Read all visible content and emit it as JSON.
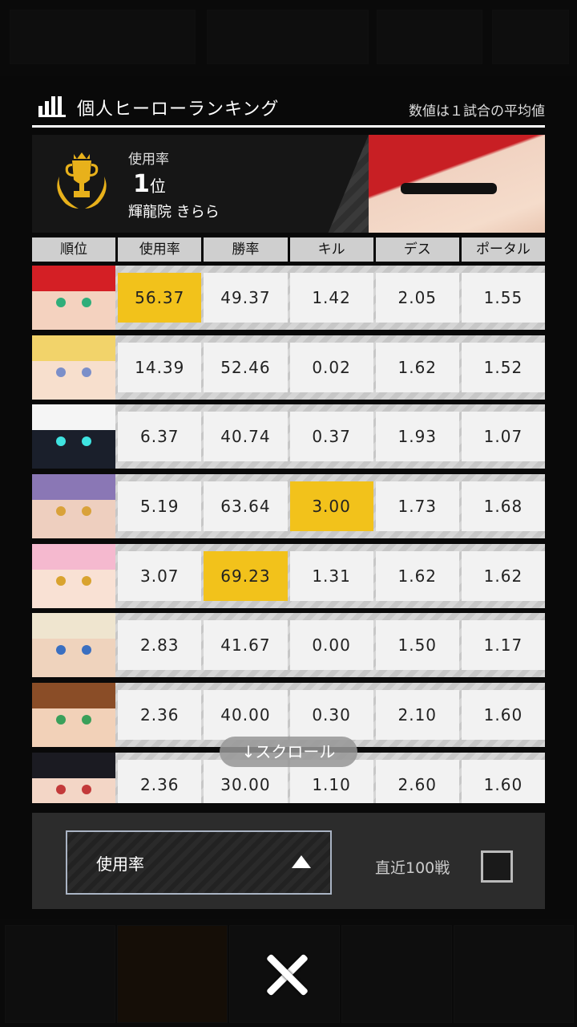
{
  "header": {
    "title": "個人ヒーローランキング",
    "note": "数値は１試合の平均値"
  },
  "banner": {
    "label": "使用率",
    "rank": "1",
    "rank_suffix": "位",
    "hero_name": "輝龍院 きらら"
  },
  "columns": [
    "順位",
    "使用率",
    "勝率",
    "キル",
    "デス",
    "ポータル"
  ],
  "rows": [
    {
      "usage": "56.37",
      "win": "49.37",
      "kill": "1.42",
      "death": "2.05",
      "portal": "1.55",
      "hl": "usage",
      "hair": "#d41f25",
      "skin": "#f4d2bf",
      "eye": "#2fae7a"
    },
    {
      "usage": "14.39",
      "win": "52.46",
      "kill": "0.02",
      "death": "1.62",
      "portal": "1.52",
      "hl": "",
      "hair": "#f2d36a",
      "skin": "#f7dfcd",
      "eye": "#7b8fc9"
    },
    {
      "usage": "6.37",
      "win": "40.74",
      "kill": "0.37",
      "death": "1.93",
      "portal": "1.07",
      "hl": "",
      "hair": "#f5f5f5",
      "skin": "#1a1f2b",
      "eye": "#3fe3e0"
    },
    {
      "usage": "5.19",
      "win": "63.64",
      "kill": "3.00",
      "death": "1.73",
      "portal": "1.68",
      "hl": "kill",
      "hair": "#8a77b5",
      "skin": "#eecfbf",
      "eye": "#d9a23a"
    },
    {
      "usage": "3.07",
      "win": "69.23",
      "kill": "1.31",
      "death": "1.62",
      "portal": "1.62",
      "hl": "win",
      "hair": "#f5b9cf",
      "skin": "#f9e1d4",
      "eye": "#d9a32f"
    },
    {
      "usage": "2.83",
      "win": "41.67",
      "kill": "0.00",
      "death": "1.50",
      "portal": "1.17",
      "hl": "",
      "hair": "#efe5cf",
      "skin": "#efd3bd",
      "eye": "#3a6fc1"
    },
    {
      "usage": "2.36",
      "win": "40.00",
      "kill": "0.30",
      "death": "2.10",
      "portal": "1.60",
      "hl": "",
      "hair": "#8a4d27",
      "skin": "#f2d1b8",
      "eye": "#3aa05a"
    },
    {
      "usage": "2.36",
      "win": "30.00",
      "kill": "1.10",
      "death": "2.60",
      "portal": "1.60",
      "hl": "",
      "hair": "#1b1b22",
      "skin": "#f3d6c6",
      "eye": "#c33a3a"
    }
  ],
  "scroll_hint": "↓スクロール",
  "footer": {
    "sort_value": "使用率",
    "recent_label": "直近100戦"
  },
  "icons": {
    "chart": "bar-chart-icon",
    "trophy": "trophy-icon",
    "close": "close-icon",
    "dropdown": "triangle-up-icon"
  }
}
